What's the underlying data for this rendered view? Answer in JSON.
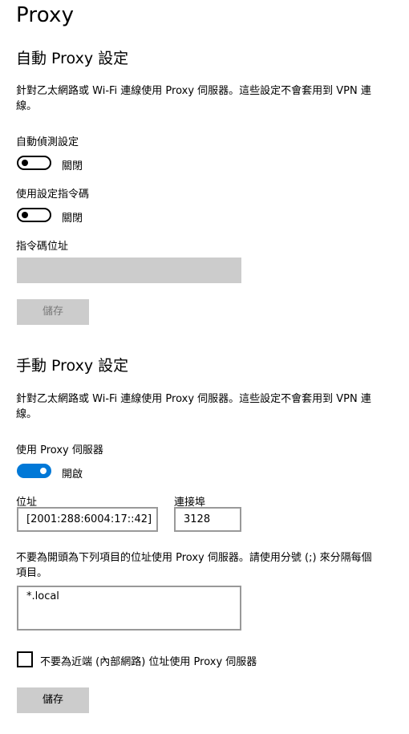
{
  "page_title": "Proxy",
  "auto": {
    "heading": "自動 Proxy 設定",
    "description": "針對乙太網路或 Wi-Fi 連線使用 Proxy 伺服器。這些設定不會套用到 VPN 連線。",
    "detect_label": "自動偵測設定",
    "detect_state": "關閉",
    "script_label": "使用設定指令碼",
    "script_state": "關閉",
    "address_label": "指令碼位址",
    "address_value": "",
    "save_label": "儲存"
  },
  "manual": {
    "heading": "手動 Proxy 設定",
    "description": "針對乙太網路或 Wi-Fi 連線使用 Proxy 伺服器。這些設定不會套用到 VPN 連線。",
    "use_proxy_label": "使用 Proxy 伺服器",
    "use_proxy_state": "開啟",
    "address_label": "位址",
    "address_value": "[2001:288:6004:17::42]",
    "port_label": "連接埠",
    "port_value": "3128",
    "exceptions_label": "不要為開頭為下列項目的位址使用 Proxy 伺服器。請使用分號 (;) 來分隔每個項目。",
    "exceptions_value": "*.local",
    "local_bypass_label": "不要為近端 (內部網路) 位址使用 Proxy 伺服器",
    "save_label": "儲存"
  },
  "colors": {
    "accent": "#0078d7",
    "disabled_bg": "#cccccc",
    "border": "#999999"
  },
  "icons": {
    "toggle_off": "toggle-off-icon",
    "toggle_on": "toggle-on-icon",
    "checkbox": "checkbox-unchecked-icon"
  }
}
